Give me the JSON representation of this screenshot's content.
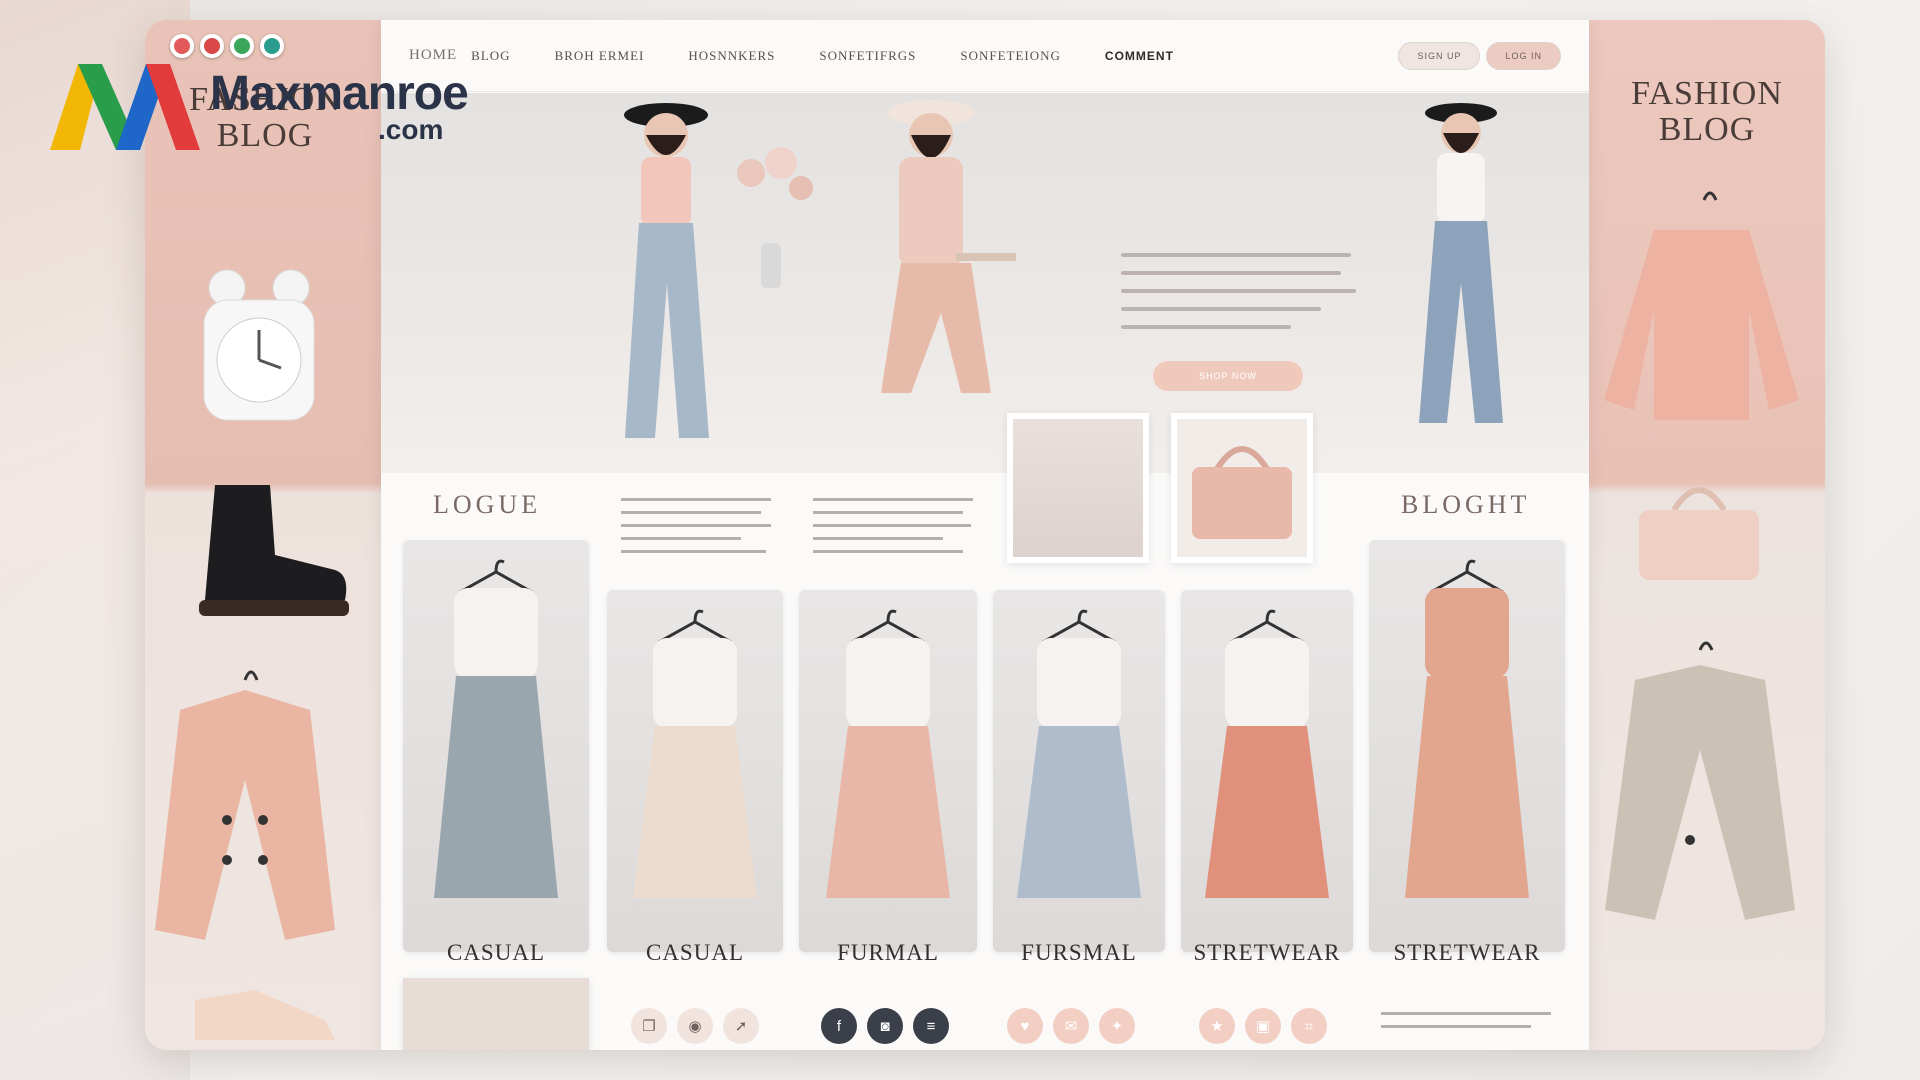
{
  "watermark": {
    "name": "Maxmanroe",
    "domain": ".com"
  },
  "window": {
    "dots": [
      "#e35a5a",
      "#3ba55c",
      "#2a9d8f"
    ]
  },
  "side": {
    "left_title": "FASHION\nBLOG",
    "right_title": "FASHION\nBLOG"
  },
  "nav": {
    "items": [
      "HOME",
      "BLOG",
      "BROH ERMEI",
      "HOSNNKERS",
      "SONFETIFRGS",
      "SONFETEIONG",
      "COMMENT"
    ],
    "actions": [
      "SIGN UP",
      "LOG IN"
    ]
  },
  "hero": {
    "cta": "SHOP NOW"
  },
  "sections": {
    "left_head": "LOGUE",
    "right_head": "BLOGHT"
  },
  "categories": [
    {
      "label": "CASUAL",
      "garment": "pleated-trousers",
      "color": "#9aa6ae"
    },
    {
      "label": "CASUAL",
      "garment": "blazer-outfit",
      "color": "#ecdccf"
    },
    {
      "label": "FURMAL",
      "garment": "tulle-dress",
      "color": "#e9b7a7"
    },
    {
      "label": "FURSMAL",
      "garment": "blue-skirt",
      "color": "#aebccb"
    },
    {
      "label": "STRETWEAR",
      "garment": "pleated-skirt",
      "color": "#e0907b"
    },
    {
      "label": "STRETWEAR",
      "garment": "pink-set",
      "color": "#e2a58e"
    }
  ],
  "social_icons": [
    {
      "name": "bookmark-icon",
      "style": "light"
    },
    {
      "name": "camera-icon",
      "style": "light"
    },
    {
      "name": "share-icon",
      "style": "light"
    },
    {
      "name": "facebook-icon",
      "style": "dark",
      "glyph": "f"
    },
    {
      "name": "instagram-icon",
      "style": "dark",
      "glyph": "◙"
    },
    {
      "name": "menu-icon",
      "style": "dark",
      "glyph": "≡"
    },
    {
      "name": "heart-icon",
      "style": "pink"
    },
    {
      "name": "chat-icon",
      "style": "pink"
    },
    {
      "name": "tag-icon",
      "style": "pink"
    },
    {
      "name": "star-icon",
      "style": "pink"
    },
    {
      "name": "bag-icon",
      "style": "pink"
    },
    {
      "name": "link-icon",
      "style": "pink"
    }
  ]
}
